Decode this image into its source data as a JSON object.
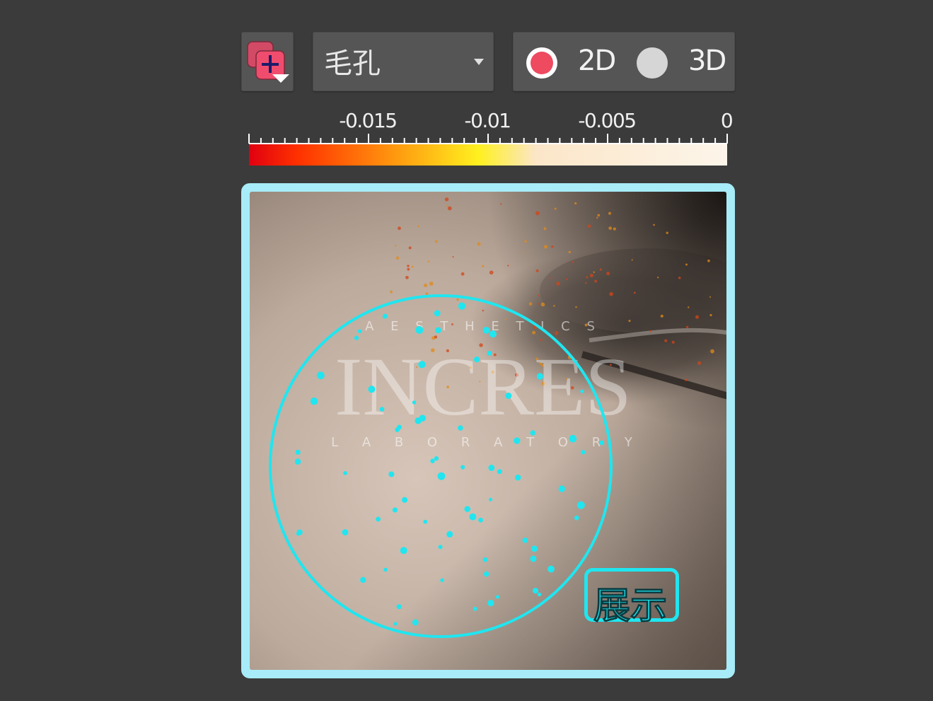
{
  "toolbar": {
    "add_layer_icon": "add-layer-icon",
    "mode_value": "毛孔",
    "view_options": [
      {
        "label": "2D",
        "selected": true
      },
      {
        "label": "3D",
        "selected": false
      }
    ],
    "accent_color": "#ee4a60"
  },
  "colorbar": {
    "tick_labels": [
      "-0.015",
      "-0.01",
      "-0.005",
      "0"
    ],
    "min": -0.02,
    "max": 0,
    "gradient": [
      "#e00010",
      "#ff3000",
      "#ffa010",
      "#fff020",
      "#fbe6c8",
      "#fdf5ea"
    ]
  },
  "viewer": {
    "watermark_top": "A E S T H E T I C S",
    "watermark_brand": "INCRES",
    "watermark_bottom": "L A B O R A T O R Y",
    "roi_color": "#1fe6f0",
    "show_button_label": "展示"
  }
}
